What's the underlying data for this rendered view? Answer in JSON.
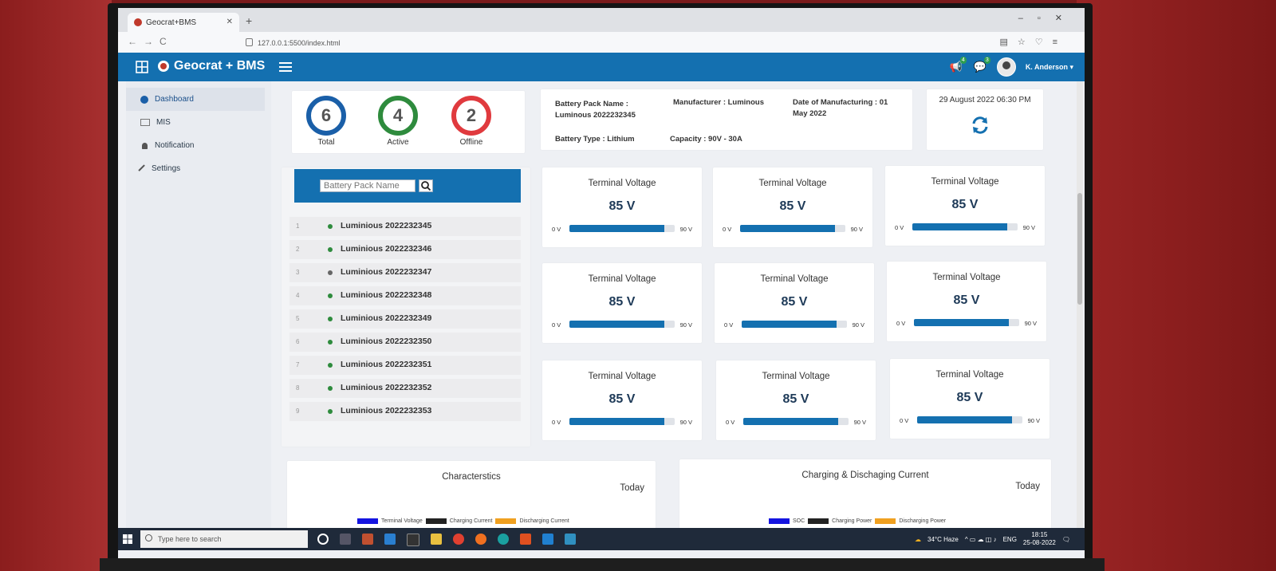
{
  "browser": {
    "tab_title": "Geocrat+BMS",
    "url": "127.0.0.1:5500/index.html"
  },
  "header": {
    "brand": "Geocrat + BMS",
    "alerts_count": "4",
    "messages_count": "3",
    "user_name": "K. Anderson ▾"
  },
  "sidebar": {
    "items": [
      {
        "label": "Dashboard",
        "icon": "dashboard-icon",
        "active": true
      },
      {
        "label": "MIS",
        "icon": "mis-icon"
      },
      {
        "label": "Notification",
        "icon": "bell-icon"
      },
      {
        "label": "Settings",
        "icon": "wrench-icon"
      }
    ]
  },
  "stats": {
    "total": {
      "value": "6",
      "label": "Total",
      "color": "#1a5fa8"
    },
    "active": {
      "value": "4",
      "label": "Active",
      "color": "#2e8b3d"
    },
    "offline": {
      "value": "2",
      "label": "Offline",
      "color": "#e03a3e"
    }
  },
  "pack_info": {
    "name": "Battery Pack Name : Luminous 2022232345",
    "manufacturer": "Manufacturer : Luminous",
    "dom": "Date of Manufacturing : 01 May 2022",
    "type": "Battery Type : Lithium",
    "capacity": "Capacity : 90V - 30A"
  },
  "datetime": "29 August 2022 06:30 PM",
  "battery_list": {
    "search_placeholder": "Battery Pack Name",
    "items": [
      {
        "n": "1",
        "name": "Luminious 2022232345",
        "status": "online"
      },
      {
        "n": "2",
        "name": "Luminious 2022232346",
        "status": "online"
      },
      {
        "n": "3",
        "name": "Luminious 2022232347",
        "status": "offline"
      },
      {
        "n": "4",
        "name": "Luminious 2022232348",
        "status": "online"
      },
      {
        "n": "5",
        "name": "Luminious 2022232349",
        "status": "online"
      },
      {
        "n": "6",
        "name": "Luminious 2022232350",
        "status": "online"
      },
      {
        "n": "7",
        "name": "Luminious 2022232351",
        "status": "online"
      },
      {
        "n": "8",
        "name": "Luminious 2022232352",
        "status": "online"
      },
      {
        "n": "9",
        "name": "Luminious 2022232353",
        "status": "online"
      }
    ]
  },
  "voltage_cards": [
    {
      "title": "Terminal Voltage",
      "value": "85 V",
      "min": "0 V",
      "max": "90 V",
      "level": 0.9
    },
    {
      "title": "Terminal Voltage",
      "value": "85 V",
      "min": "0 V",
      "max": "90 V",
      "level": 0.9
    },
    {
      "title": "Terminal Voltage",
      "value": "85 V",
      "min": "0 V",
      "max": "90 V",
      "level": 0.9
    },
    {
      "title": "Terminal Voltage",
      "value": "85 V",
      "min": "0 V",
      "max": "90 V",
      "level": 0.9
    },
    {
      "title": "Terminal Voltage",
      "value": "85 V",
      "min": "0 V",
      "max": "90 V",
      "level": 0.9
    },
    {
      "title": "Terminal Voltage",
      "value": "85 V",
      "min": "0 V",
      "max": "90 V",
      "level": 0.9
    },
    {
      "title": "Terminal Voltage",
      "value": "85 V",
      "min": "0 V",
      "max": "90 V",
      "level": 0.9
    },
    {
      "title": "Terminal Voltage",
      "value": "85 V",
      "min": "0 V",
      "max": "90 V",
      "level": 0.9
    },
    {
      "title": "Terminal Voltage",
      "value": "85 V",
      "min": "0 V",
      "max": "90 V",
      "level": 0.9
    }
  ],
  "charts": [
    {
      "title": "Characterstics",
      "period": "Today",
      "legend": [
        {
          "label": "Terminal Voltage",
          "color": "#1414e0"
        },
        {
          "label": "Charging Current",
          "color": "#222222"
        },
        {
          "label": "Discharging Current",
          "color": "#f0a020"
        }
      ]
    },
    {
      "title": "Charging & Dischaging Current",
      "period": "Today",
      "legend": [
        {
          "label": "SOC",
          "color": "#1414e0"
        },
        {
          "label": "Charging Power",
          "color": "#222222"
        },
        {
          "label": "Discharging Power",
          "color": "#f0a020"
        }
      ]
    }
  ],
  "colors": {
    "primary": "#1470b0",
    "online": "#2e8b3d",
    "offline": "#666666"
  },
  "taskbar": {
    "search_placeholder": "Type here to search",
    "weather": "34°C  Haze",
    "lang": "ENG",
    "time": "18:15",
    "date": "25-08-2022"
  }
}
